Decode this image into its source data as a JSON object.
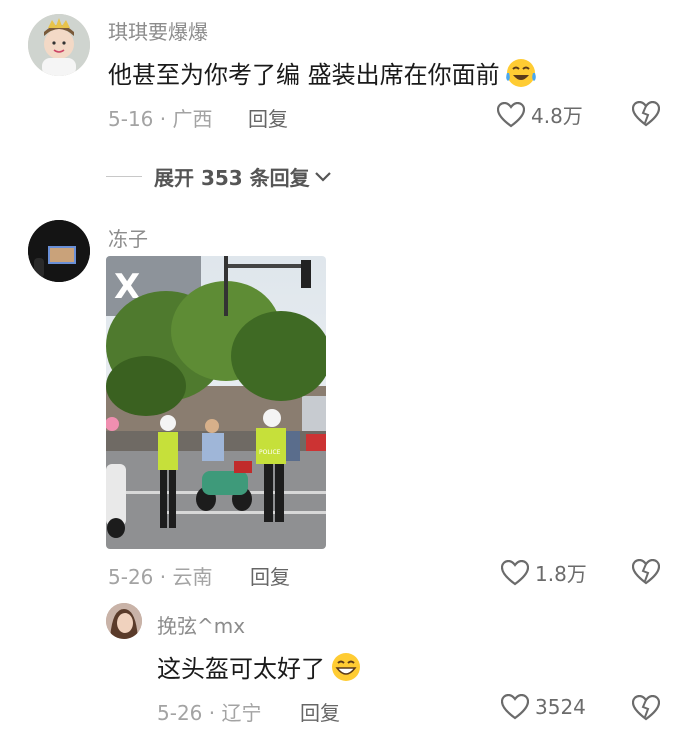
{
  "comments": [
    {
      "username": "琪琪要爆爆",
      "text": "他甚至为你考了编 盛装出席在你面前",
      "emoji": "crying-laughing-emoji",
      "date_location": "5-16 · 广西",
      "reply_label": "回复",
      "like_count": "4.8万",
      "expand_label": "展开 353 条回复"
    },
    {
      "username": "冻子",
      "date_location": "5-26 · 云南",
      "reply_label": "回复",
      "like_count": "1.8万"
    },
    {
      "username": "挽弦^mx",
      "text": "这头盔可太好了",
      "emoji": "grinning-emoji",
      "date_location": "5-26 · 辽宁",
      "reply_label": "回复",
      "like_count": "3524"
    }
  ],
  "photo": {
    "sign_text": "X",
    "police_label": "POLICE"
  },
  "colors": {
    "like_icon": "#6b6b6b",
    "meta_text": "#a3a3a3",
    "username": "#8c8c8c"
  }
}
